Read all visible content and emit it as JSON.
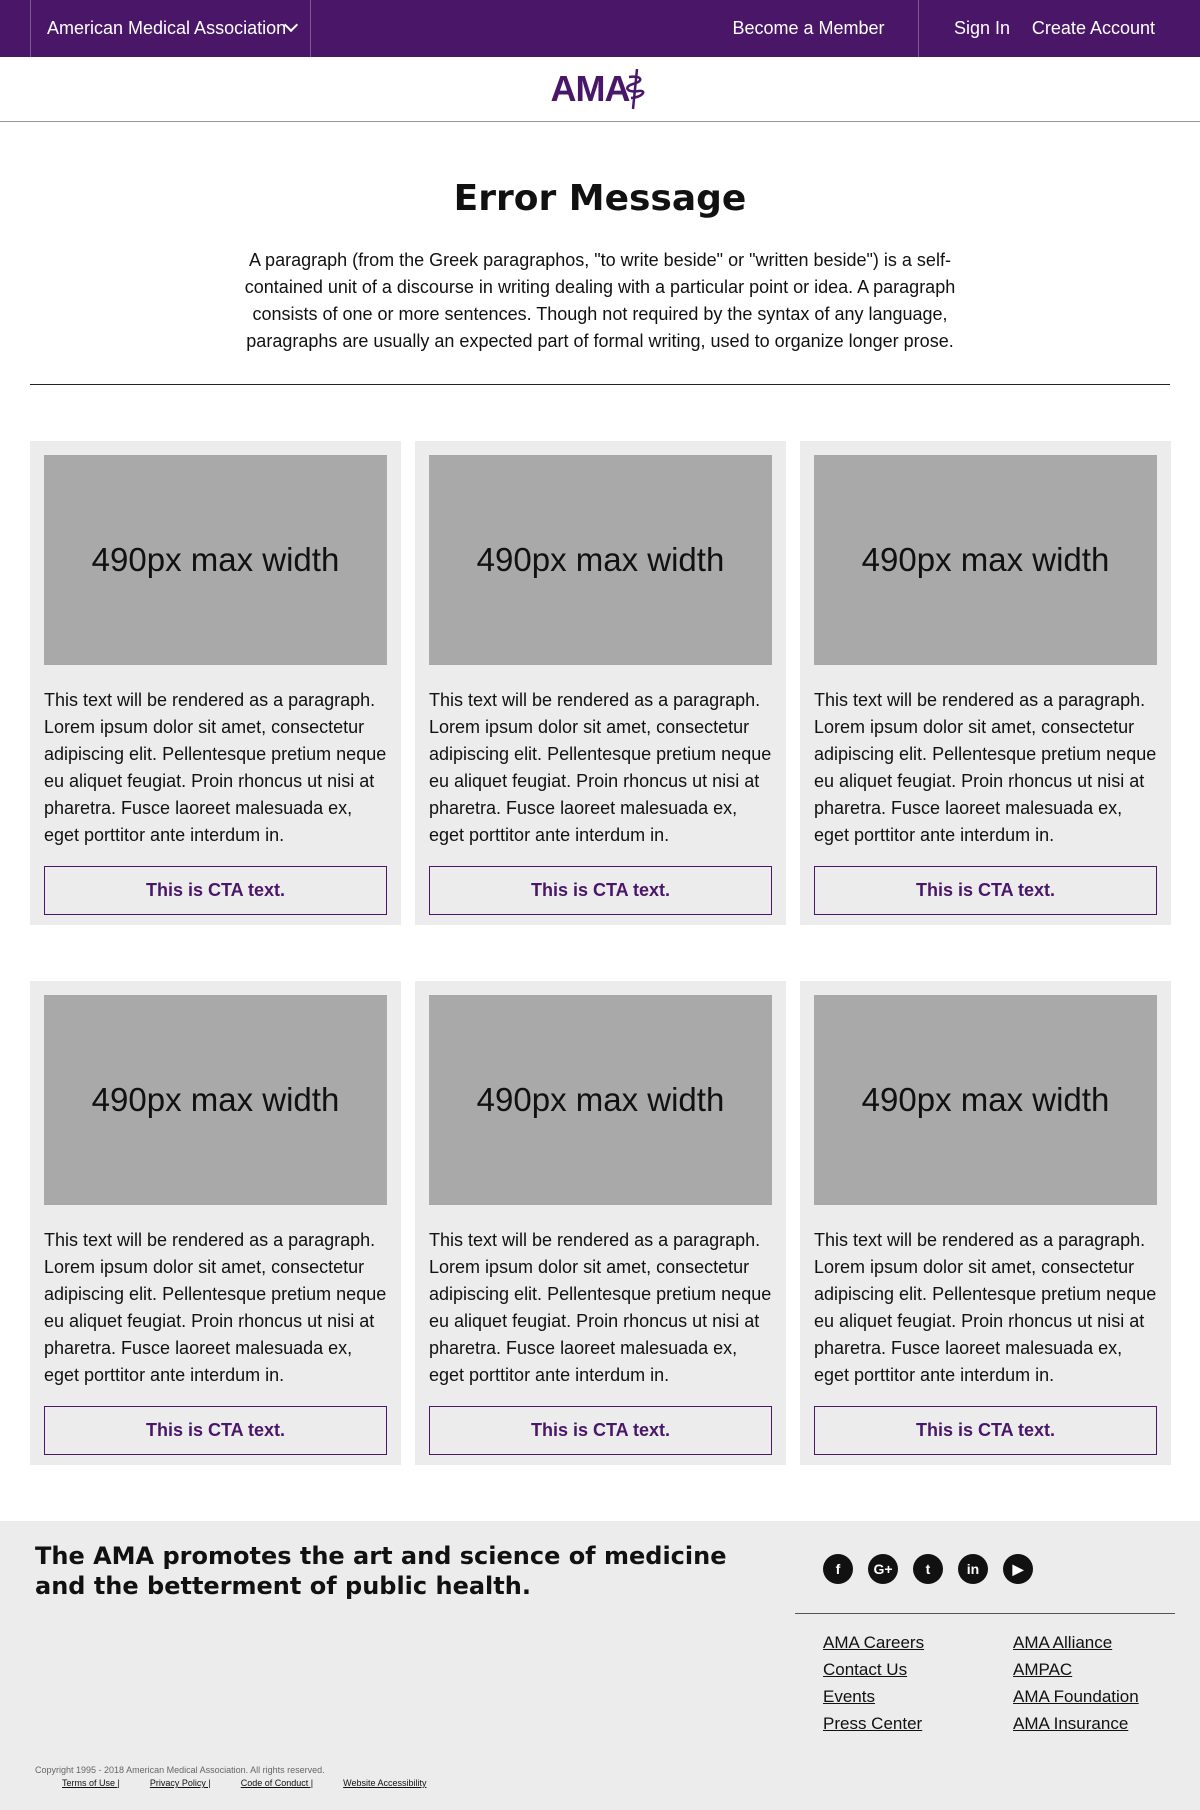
{
  "topnav": {
    "org_label": "American Medical Association",
    "become_member": "Become a Member",
    "sign_in": "Sign In",
    "create_account": "Create Account"
  },
  "logo": {
    "text": "AMA"
  },
  "hero": {
    "title": "Error Message",
    "body": "A paragraph (from the Greek paragraphos, \"to write beside\" or \"written beside\") is a self-contained unit of a discourse in writing dealing with a particular point or idea. A paragraph consists of one or more sentences. Though not required by the syntax of any language, paragraphs are usually an expected part of formal writing, used to organize longer prose."
  },
  "cards": [
    {
      "image_label": "490px max width",
      "text": "This text will be rendered as a paragraph. Lorem ipsum dolor sit amet, consectetur adipiscing elit. Pellentesque pretium neque eu aliquet feugiat. Proin rhoncus ut nisi at pharetra. Fusce laoreet malesuada ex, eget porttitor ante interdum in.",
      "cta": "This is CTA text."
    },
    {
      "image_label": "490px max width",
      "text": "This text will be rendered as a paragraph. Lorem ipsum dolor sit amet, consectetur adipiscing elit. Pellentesque pretium neque eu aliquet feugiat. Proin rhoncus ut nisi at pharetra. Fusce laoreet malesuada ex, eget porttitor ante interdum in.",
      "cta": "This is CTA text."
    },
    {
      "image_label": "490px max width",
      "text": "This text will be rendered as a paragraph. Lorem ipsum dolor sit amet, consectetur adipiscing elit. Pellentesque pretium neque eu aliquet feugiat. Proin rhoncus ut nisi at pharetra. Fusce laoreet malesuada ex, eget porttitor ante interdum in.",
      "cta": "This is CTA text."
    },
    {
      "image_label": "490px max width",
      "text": "This text will be rendered as a paragraph. Lorem ipsum dolor sit amet, consectetur adipiscing elit. Pellentesque pretium neque eu aliquet feugiat. Proin rhoncus ut nisi at pharetra. Fusce laoreet malesuada ex, eget porttitor ante interdum in.",
      "cta": "This is CTA text."
    },
    {
      "image_label": "490px max width",
      "text": "This text will be rendered as a paragraph. Lorem ipsum dolor sit amet, consectetur adipiscing elit. Pellentesque pretium neque eu aliquet feugiat. Proin rhoncus ut nisi at pharetra. Fusce laoreet malesuada ex, eget porttitor ante interdum in.",
      "cta": "This is CTA text."
    },
    {
      "image_label": "490px max width",
      "text": "This text will be rendered as a paragraph. Lorem ipsum dolor sit amet, consectetur adipiscing elit. Pellentesque pretium neque eu aliquet feugiat. Proin rhoncus ut nisi at pharetra. Fusce laoreet malesuada ex, eget porttitor ante interdum in.",
      "cta": "This is CTA text."
    }
  ],
  "footer": {
    "tagline": "The AMA promotes the art and science of medicine and the betterment of public health.",
    "social": [
      {
        "icon": "facebook-icon",
        "glyph": "f"
      },
      {
        "icon": "google-plus-icon",
        "glyph": "G+"
      },
      {
        "icon": "twitter-icon",
        "glyph": "t"
      },
      {
        "icon": "linkedin-icon",
        "glyph": "in"
      },
      {
        "icon": "youtube-icon",
        "glyph": "▶"
      }
    ],
    "links_col1": [
      "AMA Careers",
      "Contact Us",
      "Events",
      "Press Center"
    ],
    "links_col2": [
      "AMA Alliance",
      "AMPAC",
      "AMA Foundation",
      "AMA Insurance"
    ],
    "copyright": "Copyright 1995 - 2018 American Medical Association. All rights reserved.",
    "legal": [
      "Terms of Use |",
      "Privacy Policy |",
      "Code of Conduct |",
      "Website Accessibility"
    ]
  },
  "colors": {
    "brand": "#4a1768",
    "card_bg": "#ececec",
    "placeholder": "#a9a9a9"
  }
}
